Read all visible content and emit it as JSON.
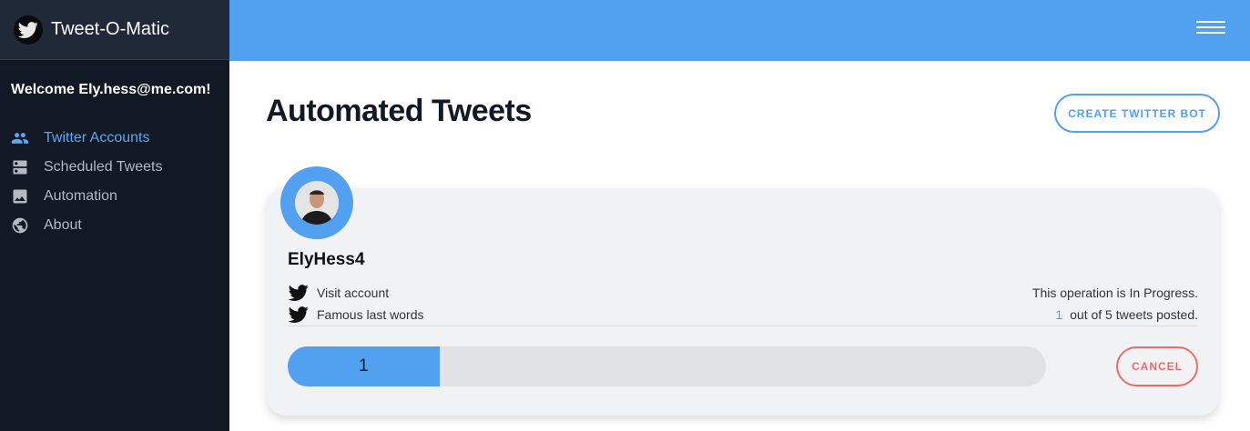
{
  "app": {
    "title": "Tweet-O-Matic"
  },
  "sidebar": {
    "welcome": "Welcome Ely.hess@me.com!",
    "items": [
      {
        "label": "Twitter Accounts",
        "icon": "users-icon",
        "active": true
      },
      {
        "label": "Scheduled Tweets",
        "icon": "server-icon",
        "active": false
      },
      {
        "label": "Automation",
        "icon": "image-icon",
        "active": false
      },
      {
        "label": "About",
        "icon": "globe-icon",
        "active": false
      }
    ]
  },
  "main": {
    "title": "Automated Tweets",
    "create_button": "CREATE TWITTER BOT"
  },
  "card": {
    "username": "ElyHess4",
    "visit_label": "Visit account",
    "tweet_label": "Famous last words",
    "status": "This operation is In Progress.",
    "posted_count": "1",
    "posted_suffix": "out of 5 tweets posted.",
    "progress_label": "1",
    "progress_fraction": 0.2,
    "cancel_button": "CANCEL"
  },
  "colors": {
    "accent": "#52a0f0",
    "sidebar_bg": "#121824",
    "cancel": "#ef6b6b"
  }
}
